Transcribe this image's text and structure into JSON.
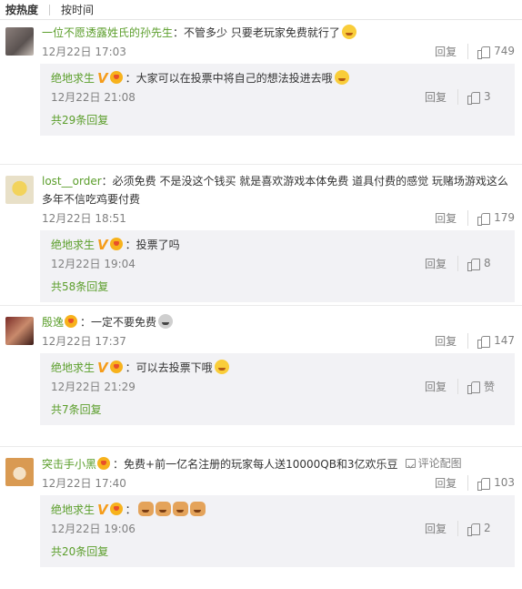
{
  "sort": {
    "by_hot": "按热度",
    "by_time": "按时间"
  },
  "labels": {
    "reply": "回复",
    "pic_comment": "评论配图"
  },
  "comments": [
    {
      "user": "一位不愿透露姓氏的孙先生",
      "text": "：不管多少 只要老玩家免费就行了",
      "time": "12月22日 17:03",
      "likes": "749",
      "reply": {
        "user": "绝地求生",
        "text": "：大家可以在投票中将自己的想法投进去哦",
        "time": "12月22日 21:08",
        "likes": "3",
        "more": "共29条回复"
      }
    },
    {
      "user": "lost__order",
      "text": "：必须免费 不是没这个钱买 就是喜欢游戏本体免费 道具付费的感觉 玩赌场游戏这么多年不信吃鸡要付费",
      "time": "12月22日 18:51",
      "likes": "179",
      "reply": {
        "user": "绝地求生",
        "text": "：投票了吗",
        "time": "12月22日 19:04",
        "likes": "8",
        "more": "共58条回复"
      }
    },
    {
      "user": "殷逸",
      "text": "：一定不要免费",
      "time": "12月22日 17:37",
      "likes": "147",
      "reply": {
        "user": "绝地求生",
        "text": "：可以去投票下哦",
        "time": "12月22日 21:29",
        "likes": "赞",
        "more": "共7条回复"
      }
    },
    {
      "user": "突击手小黑",
      "text": "：免费+前一亿名注册的玩家每人送10000QB和3亿欢乐豆",
      "time": "12月22日 17:40",
      "likes": "103",
      "reply": {
        "user": "绝地求生",
        "text": "：",
        "time": "12月22日 19:06",
        "likes": "2",
        "more": "共20条回复"
      }
    }
  ]
}
